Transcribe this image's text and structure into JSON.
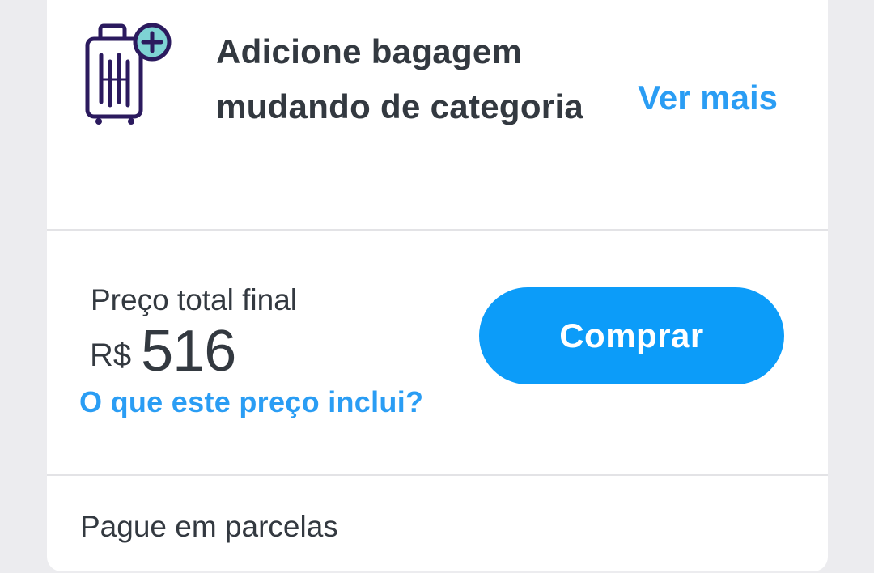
{
  "baggage": {
    "icon": "suitcase-plus-icon",
    "title": "Adicione bagagem mudando de categoria",
    "link_label": "Ver mais"
  },
  "pricing": {
    "label": "Preço total final",
    "currency": "R$",
    "amount": "516",
    "info_link": "O que este preço inclui?",
    "buy_label": "Comprar"
  },
  "installments": {
    "label": "Pague em parcelas"
  },
  "colors": {
    "accent": "#0c9cf9",
    "link": "#2a9df4",
    "icon_stroke": "#2b1a5e",
    "icon_accent": "#7ed3d4",
    "text": "#333940"
  }
}
